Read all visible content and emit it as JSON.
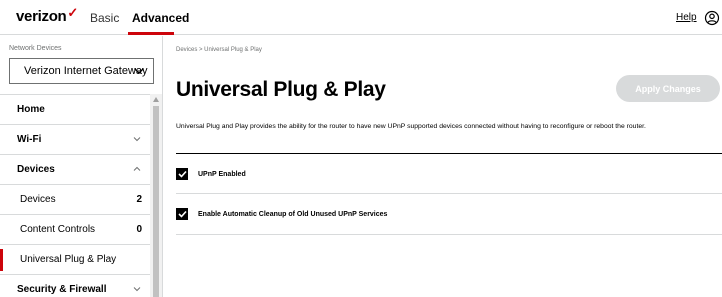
{
  "header": {
    "logo_text": "verizon",
    "logo_mark": "✓",
    "tabs": [
      {
        "label": "Basic"
      },
      {
        "label": "Advanced"
      }
    ],
    "help_label": "Help",
    "account_icon": "account-circle-icon"
  },
  "sidebar": {
    "device_label": "Network Devices",
    "device_selected": "Verizon Internet Gateway",
    "items": [
      {
        "label": "Home"
      },
      {
        "label": "Wi-Fi"
      },
      {
        "label": "Devices"
      },
      {
        "label": "Devices",
        "count": "2"
      },
      {
        "label": "Content Controls",
        "count": "0"
      },
      {
        "label": "Universal Plug & Play"
      },
      {
        "label": "Security & Firewall"
      }
    ]
  },
  "main": {
    "breadcrumb": "Devices  >  Universal Plug & Play",
    "title": "Universal Plug & Play",
    "apply_label": "Apply Changes",
    "description": "Universal Plug and Play provides the ability for the router to have new UPnP supported devices connected without having to reconfigure or reboot the router.",
    "options": [
      {
        "label": "UPnP Enabled",
        "checked": true
      },
      {
        "label": "Enable Automatic Cleanup of Old Unused UPnP Services",
        "checked": true
      }
    ]
  },
  "colors": {
    "brand_red": "#cd040b",
    "disabled_button": "#d8dadb",
    "divider": "#d8dadb"
  }
}
